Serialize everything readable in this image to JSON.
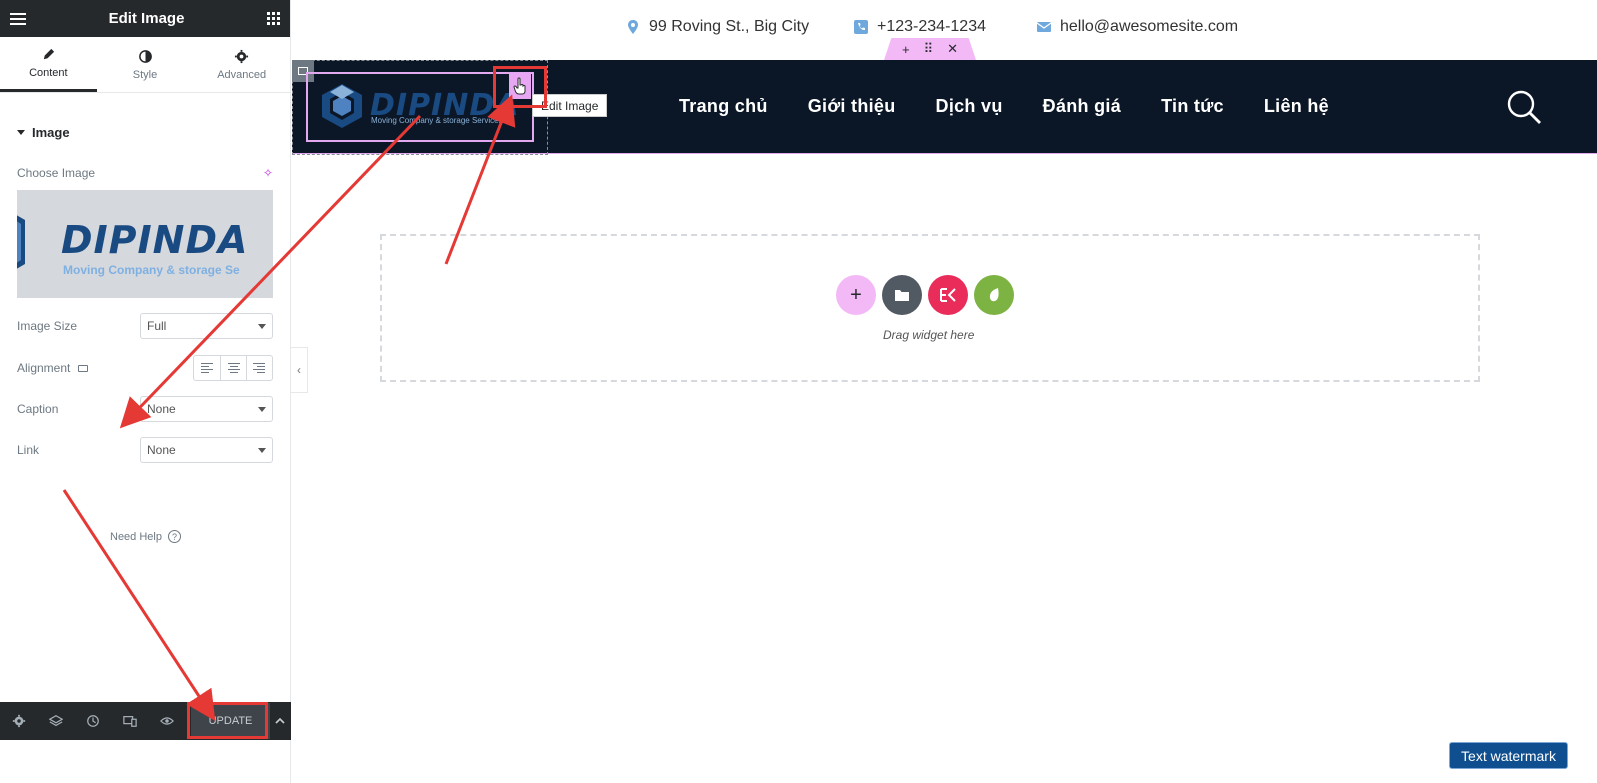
{
  "panel": {
    "title": "Edit Image",
    "tabs": [
      {
        "label": "Content"
      },
      {
        "label": "Style"
      },
      {
        "label": "Advanced"
      }
    ],
    "section_title": "Image",
    "choose_image_label": "Choose Image",
    "preview": {
      "logo_text": "DIPINDA",
      "tagline": "Moving Company & storage Se"
    },
    "image_size": {
      "label": "Image Size",
      "value": "Full"
    },
    "alignment": {
      "label": "Alignment"
    },
    "caption": {
      "label": "Caption",
      "value": "None"
    },
    "link": {
      "label": "Link",
      "value": "None"
    },
    "need_help": "Need Help",
    "footer": {
      "update_label": "UPDATE"
    }
  },
  "site": {
    "contacts": {
      "address": "99 Roving St., Big City",
      "phone": "+123-234-1234",
      "email": "hello@awesomesite.com"
    },
    "logo": {
      "text": "DIPINDA",
      "tagline": "Moving Company & storage Services"
    },
    "edit_tooltip": "Edit Image",
    "nav": [
      "Trang chủ",
      "Giới thiệu",
      "Dịch vụ",
      "Đánh giá",
      "Tin tức",
      "Liên hệ"
    ],
    "drop_zone_text": "Drag widget here"
  },
  "watermark": "Text watermark",
  "colors": {
    "header_bg": "#0b1727",
    "panel_header": "#26292c",
    "accent_pink": "#e8a7f2",
    "annotation_red": "#e53935",
    "contact_icon": "#6fa8dc"
  }
}
